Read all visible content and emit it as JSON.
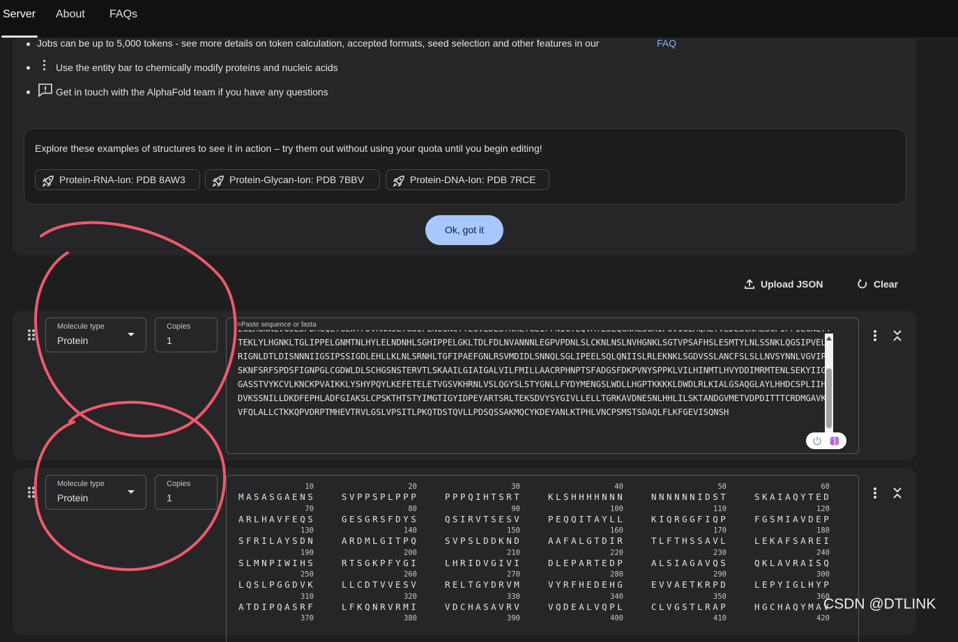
{
  "nav": {
    "tabs": [
      {
        "label": "Server"
      },
      {
        "label": "About"
      },
      {
        "label": "FAQs"
      }
    ],
    "active_tab": "Server"
  },
  "info": {
    "bullet1_text": "Jobs can be up to 5,000 tokens - see more details on token calculation, accepted formats, seed selection and other features in our ",
    "bullet1_link": "FAQ",
    "bullet2_text": "Use the entity bar to chemically modify proteins and nucleic acids",
    "bullet3_text": "Get in touch with the AlphaFold team if you have any questions"
  },
  "examples": {
    "intro": "Explore these examples of structures to see it in action – try them out without using your quota until you begin editing!",
    "chips": [
      {
        "label": "Protein-RNA-Ion: PDB 8AW3",
        "icon": "rocket-icon"
      },
      {
        "label": "Protein-Glycan-Ion: PDB 7BBV",
        "icon": "rocket-icon"
      },
      {
        "label": "Protein-DNA-Ion: PDB 7RCE",
        "icon": "rocket-icon"
      }
    ],
    "ok_label": "Ok, got it"
  },
  "toolbar": {
    "upload_label": "Upload JSON",
    "clear_label": "Clear"
  },
  "entries": [
    {
      "molecule_type_label": "Molecule type",
      "molecule_type": "Protein",
      "copies_label": "Copies",
      "copies": "1",
      "sequence_placeholder": ">Paste sequence or fasta",
      "sequence": "LGLRGNNLVGSLSPDMCQLTGLWYFDVRNNSLTGSIPENIGNCTTLGVLDLSYNKLTGEIPFNIGTLQVATLSLQGNKLSGHIPSVIGLMQALTVLDLSCNMLSGPIPPILGNLTYTEKLYLHGNKLTGLIPPELGNMTNLHYLELNDNHLSGHIPPELGKLTDLFDLNVANNNLEGPVPDNLSLCKNLNSLNVHGNKLSGTVPSAFHSLESMTYLNLSSNKLQGSIPVELSRIGNLDTLDISNNNIIGSIPSSIGDLEHLLKLNLSRNHLTGFIPAEFGNLRSVMDIDLSNNQLSGLIPEELSQLQNIISLRLEKNKLSGDVSSLANCFSLSLLNVSYNNLVGVIPTSKNFSRFSPDSFIGNPGLCGDWLDLSCHGSNSTERVTLSKAAILGIAIGALVILFMILLAACRPHNPTSFADGSFDKPVNYSPPKLVILHINMTLHVYDDIMRMTENLSEKYIIGYGASSTVYKCVLKNCKPVAIKKLYSHYPQYLKEFETELETVGSVKHRNLVSLQGYSLSTYGNLLFYDYMENGSLWDLLHGPTKKKKLDWDLRLKIALGSAQGLAYLHHDCSPLIIHRDVKSSNILLDKDFEPHLADFGIAKSLCPSKTHTSTYIMGTIGYIDPEYARTSRLTEKSDVYSYGIVLLELLTGRKAVDNESNLHHLILSKTANDGVMETVDPDITTTCRDMGAVKKVFQLALLCTKKQPVDRPTMHEVTRVLGSLVPSITLPKQTDSTQVLLPDSQSSAKMQCYKDEYANLKTPHLVNCPSMSTSDAQLFLKFGEVISQNSH"
    },
    {
      "molecule_type_label": "Molecule type",
      "molecule_type": "Protein",
      "copies_label": "Copies",
      "copies": "1",
      "residue_rows": [
        {
          "nums": [
            "10",
            "20",
            "30",
            "40",
            "50",
            "60"
          ],
          "blocks": [
            "MASASGAENS",
            "SVPPSPLPPP",
            "PPPQIHTSRT",
            "KLSHHHHNNN",
            "NNNNNNIDST",
            "SKAIAQYTED"
          ]
        },
        {
          "nums": [
            "70",
            "80",
            "90",
            "100",
            "110",
            "120"
          ],
          "blocks": [
            "ARLHAVFEQS",
            "GESGRSFDYS",
            "QSIRVTSESV",
            "PEQQITAYLL",
            "KIQRGGFIQP",
            "FGSMIAVDEP"
          ]
        },
        {
          "nums": [
            "130",
            "140",
            "150",
            "160",
            "170",
            "180"
          ],
          "blocks": [
            "SFRILAYSDN",
            "ARDMLGITPQ",
            "SVPSLDDKND",
            "AAFALGTDIR",
            "TLFTHSSAVL",
            "LEKAFSAREI"
          ]
        },
        {
          "nums": [
            "190",
            "200",
            "210",
            "220",
            "230",
            "240"
          ],
          "blocks": [
            "SLMNPIWIHS",
            "RTSGKPFYGI",
            "LHRIDVGIVI",
            "DLEPARTEDP",
            "ALSIAGAVQS",
            "QKLAVRAISQ"
          ]
        },
        {
          "nums": [
            "250",
            "260",
            "270",
            "280",
            "290",
            "300"
          ],
          "blocks": [
            "LQSLPGGDVK",
            "LLCDTVVESV",
            "RELTGYDRVM",
            "VYRFHEDEHG",
            "EVVAETKRPD",
            "LEPYIGLHYP"
          ]
        },
        {
          "nums": [
            "310",
            "320",
            "330",
            "340",
            "350",
            "360"
          ],
          "blocks": [
            "ATDIPQASRF",
            "LFKQNRVRMI",
            "VDCHASAVRV",
            "VQDEALVQPL",
            "CLVGSTLRAP",
            "HGCHAQYMAV"
          ]
        },
        {
          "nums": [
            "370",
            "380",
            "390",
            "400",
            "410",
            "420"
          ],
          "blocks": [
            "",
            "",
            "",
            "",
            "",
            ""
          ]
        }
      ]
    }
  ],
  "watermark": "CSDN @DTLINK",
  "colors": {
    "accent": "#a8c7fa",
    "link": "#8ab4f8",
    "annotation": "#f05a6a",
    "background": "#1e1e1f",
    "panel": "#262628"
  }
}
